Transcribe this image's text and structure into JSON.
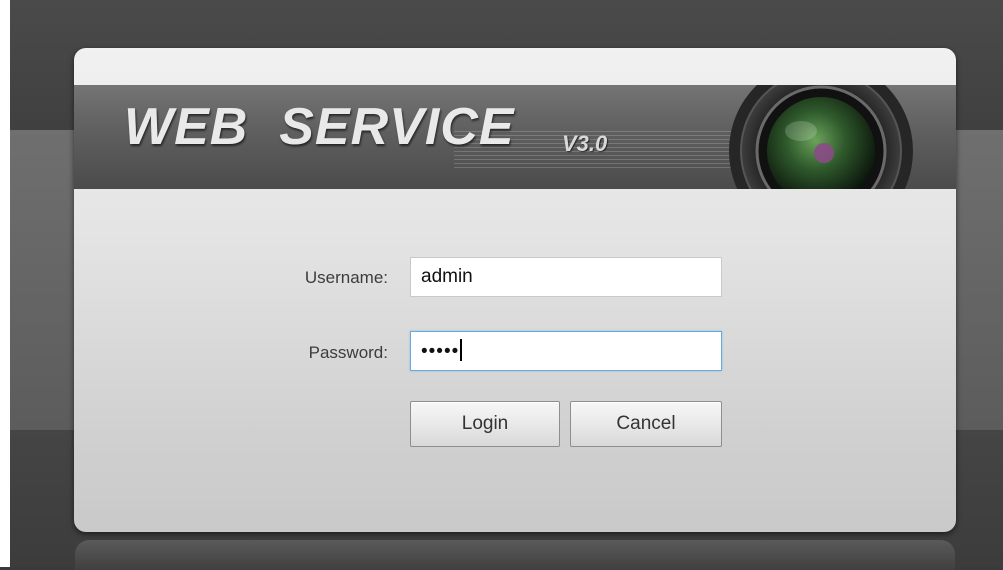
{
  "banner": {
    "brand": "WEB  SERVICE",
    "version": "V3.0",
    "lens_icon": "camera-lens-icon"
  },
  "login_form": {
    "username_label": "Username:",
    "username_value": "admin",
    "password_label": "Password:",
    "password_value": "•••••",
    "login_label": "Login",
    "cancel_label": "Cancel"
  },
  "colors": {
    "focus_border": "#6aa9d9",
    "banner_dark": "#4b4b4b",
    "dialog_light": "#f1f1f1"
  }
}
